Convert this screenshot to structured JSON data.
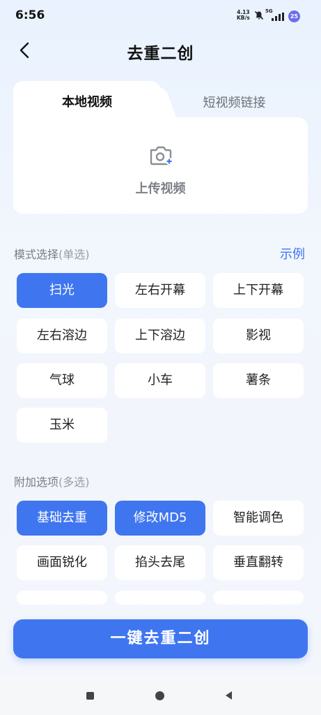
{
  "status": {
    "time": "6:56",
    "net_speed_value": "4.13",
    "net_speed_unit": "KB/s",
    "network": "5G",
    "battery": "25"
  },
  "header": {
    "title": "去重二创"
  },
  "source_tabs": [
    {
      "label": "本地视频",
      "active": true
    },
    {
      "label": "短视频链接",
      "active": false
    }
  ],
  "upload": {
    "label": "上传视频"
  },
  "mode": {
    "title": "模式选择",
    "hint": "(单选)",
    "example_link": "示例",
    "options": [
      {
        "label": "扫光",
        "selected": true
      },
      {
        "label": "左右开幕",
        "selected": false
      },
      {
        "label": "上下开幕",
        "selected": false
      },
      {
        "label": "左右溶边",
        "selected": false
      },
      {
        "label": "上下溶边",
        "selected": false
      },
      {
        "label": "影视",
        "selected": false
      },
      {
        "label": "气球",
        "selected": false
      },
      {
        "label": "小车",
        "selected": false
      },
      {
        "label": "薯条",
        "selected": false
      },
      {
        "label": "玉米",
        "selected": false
      }
    ]
  },
  "extras": {
    "title": "附加选项",
    "hint": "(多选)",
    "options": [
      {
        "label": "基础去重",
        "selected": true
      },
      {
        "label": "修改MD5",
        "selected": true
      },
      {
        "label": "智能调色",
        "selected": false
      },
      {
        "label": "画面锐化",
        "selected": false
      },
      {
        "label": "掐头去尾",
        "selected": false
      },
      {
        "label": "垂直翻转",
        "selected": false
      }
    ]
  },
  "action": {
    "label": "一键去重二创"
  },
  "colors": {
    "accent": "#3f76f0",
    "link": "#3b74f2"
  }
}
